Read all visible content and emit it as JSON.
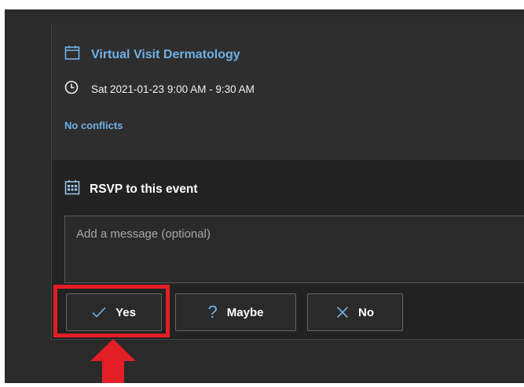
{
  "event": {
    "title": "Virtual Visit Dermatology",
    "datetime": "Sat 2021-01-23 9:00 AM - 9:30 AM",
    "conflicts_status": "No conflicts"
  },
  "rsvp": {
    "heading": "RSVP to this event",
    "message_placeholder": "Add a message (optional)",
    "message_value": "",
    "buttons": {
      "yes": "Yes",
      "maybe": "Maybe",
      "no": "No"
    }
  },
  "icons": {
    "event": "calendar-icon",
    "time": "clock-icon",
    "rsvp": "calendar-grid-icon",
    "yes": "checkmark-icon",
    "maybe": "question-mark-icon",
    "no": "x-icon",
    "annotation": "red-arrow-icon"
  },
  "colors": {
    "accent": "#6fb1e6",
    "panel": "#2d2d2d",
    "annotation": "#e41e26"
  }
}
